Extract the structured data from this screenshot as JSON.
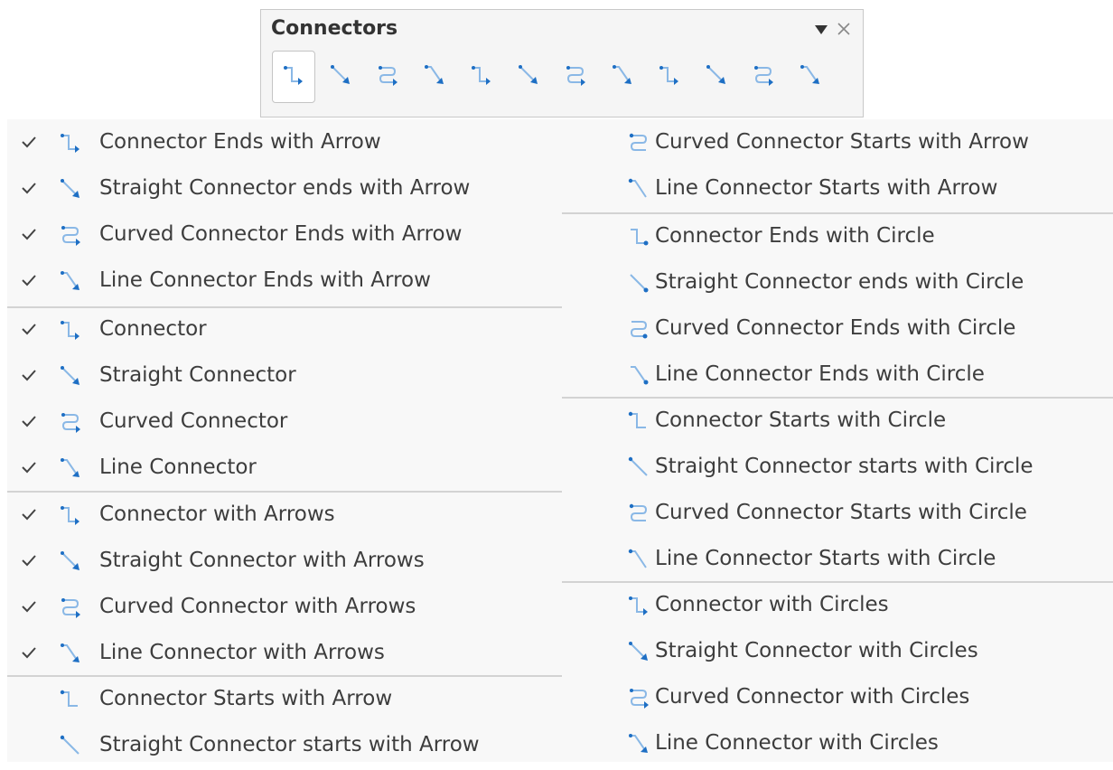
{
  "toolbar": {
    "title": "Connectors",
    "buttons": [
      {
        "icon": "connector-ends-arrow-icon",
        "active": true
      },
      {
        "icon": "straight-connector-ends-arrow-icon",
        "active": false
      },
      {
        "icon": "curved-connector-ends-arrow-icon",
        "active": false
      },
      {
        "icon": "line-connector-ends-arrow-icon",
        "active": false
      },
      {
        "icon": "connector-icon",
        "active": false
      },
      {
        "icon": "straight-connector-icon",
        "active": false
      },
      {
        "icon": "curved-connector-icon",
        "active": false
      },
      {
        "icon": "line-connector-icon",
        "active": false
      },
      {
        "icon": "connector-with-arrows-icon",
        "active": false
      },
      {
        "icon": "straight-connector-with-arrows-icon",
        "active": false
      },
      {
        "icon": "curved-connector-with-arrows-icon",
        "active": false
      },
      {
        "icon": "line-connector-with-arrows-icon",
        "active": false
      }
    ]
  },
  "menu_left": {
    "items": [
      {
        "label": "Connector Ends with Arrow",
        "checked": true,
        "icon": "connector-icon"
      },
      {
        "label": "Straight Connector ends with Arrow",
        "checked": true,
        "icon": "straight-connector-icon"
      },
      {
        "label": "Curved Connector Ends with Arrow",
        "checked": true,
        "icon": "curved-connector-icon"
      },
      {
        "label": "Line Connector Ends with Arrow",
        "checked": true,
        "icon": "line-connector-icon"
      },
      {
        "label": "Connector",
        "checked": true,
        "icon": "connector-icon"
      },
      {
        "label": "Straight Connector",
        "checked": true,
        "icon": "straight-connector-icon"
      },
      {
        "label": "Curved Connector",
        "checked": true,
        "icon": "curved-connector-icon"
      },
      {
        "label": "Line Connector",
        "checked": true,
        "icon": "line-connector-icon"
      },
      {
        "label": "Connector with Arrows",
        "checked": true,
        "icon": "connector-icon"
      },
      {
        "label": "Straight Connector with Arrows",
        "checked": true,
        "icon": "straight-connector-icon"
      },
      {
        "label": "Curved Connector with Arrows",
        "checked": true,
        "icon": "curved-connector-icon"
      },
      {
        "label": "Line Connector with Arrows",
        "checked": true,
        "icon": "line-connector-icon"
      },
      {
        "label": "Connector Starts with Arrow",
        "checked": false,
        "icon": "connector-icon"
      },
      {
        "label": "Straight Connector starts with Arrow",
        "checked": false,
        "icon": "straight-connector-icon"
      }
    ]
  },
  "menu_right": {
    "items": [
      {
        "label": "Curved Connector Starts with Arrow",
        "checked": false,
        "icon": "curved-connector-icon"
      },
      {
        "label": "Line Connector Starts with Arrow",
        "checked": false,
        "icon": "line-connector-icon"
      },
      {
        "label": "Connector Ends with Circle",
        "checked": false,
        "icon": "connector-icon"
      },
      {
        "label": "Straight Connector ends with Circle",
        "checked": false,
        "icon": "straight-connector-icon"
      },
      {
        "label": "Curved Connector Ends with Circle",
        "checked": false,
        "icon": "curved-connector-icon"
      },
      {
        "label": "Line Connector Ends with Circle",
        "checked": false,
        "icon": "line-connector-icon"
      },
      {
        "label": "Connector Starts with Circle",
        "checked": false,
        "icon": "connector-icon"
      },
      {
        "label": "Straight Connector starts with Circle",
        "checked": false,
        "icon": "straight-connector-icon"
      },
      {
        "label": "Curved Connector Starts with Circle",
        "checked": false,
        "icon": "curved-connector-icon"
      },
      {
        "label": "Line Connector Starts with Circle",
        "checked": false,
        "icon": "line-connector-icon"
      },
      {
        "label": "Connector with Circles",
        "checked": false,
        "icon": "connector-icon"
      },
      {
        "label": "Straight Connector with Circles",
        "checked": false,
        "icon": "straight-connector-icon"
      },
      {
        "label": "Curved Connector with Circles",
        "checked": false,
        "icon": "curved-connector-icon"
      },
      {
        "label": "Line Connector with Circles",
        "checked": false,
        "icon": "line-connector-icon"
      }
    ]
  },
  "colors": {
    "icon_blue": "#1e6fc4",
    "icon_light": "#8ab8e6",
    "check": "#444444",
    "separator": "#d3d3d3"
  }
}
